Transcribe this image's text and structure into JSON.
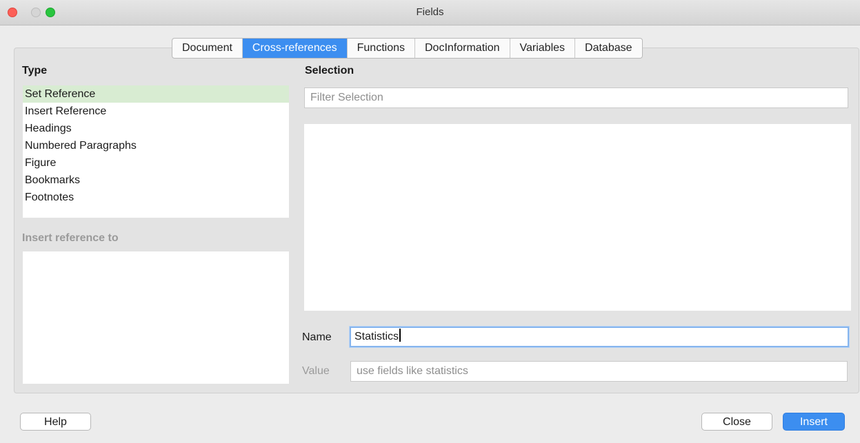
{
  "window": {
    "title": "Fields"
  },
  "tabs": [
    {
      "label": "Document",
      "active": false
    },
    {
      "label": "Cross-references",
      "active": true
    },
    {
      "label": "Functions",
      "active": false
    },
    {
      "label": "DocInformation",
      "active": false
    },
    {
      "label": "Variables",
      "active": false
    },
    {
      "label": "Database",
      "active": false
    }
  ],
  "type_section": {
    "label": "Type",
    "items": [
      "Set Reference",
      "Insert Reference",
      "Headings",
      "Numbered Paragraphs",
      "Figure",
      "Bookmarks",
      "Footnotes"
    ],
    "selected": "Set Reference"
  },
  "insert_reference_section": {
    "label": "Insert reference to"
  },
  "selection_section": {
    "label": "Selection",
    "filter_placeholder": "Filter Selection"
  },
  "name_field": {
    "label": "Name",
    "value": "Statistics"
  },
  "value_field": {
    "label": "Value",
    "placeholder": "use fields like statistics"
  },
  "buttons": {
    "help": "Help",
    "close": "Close",
    "insert": "Insert"
  },
  "colors": {
    "accent": "#3c8ef0",
    "selected_row": "#d8ecd2"
  }
}
